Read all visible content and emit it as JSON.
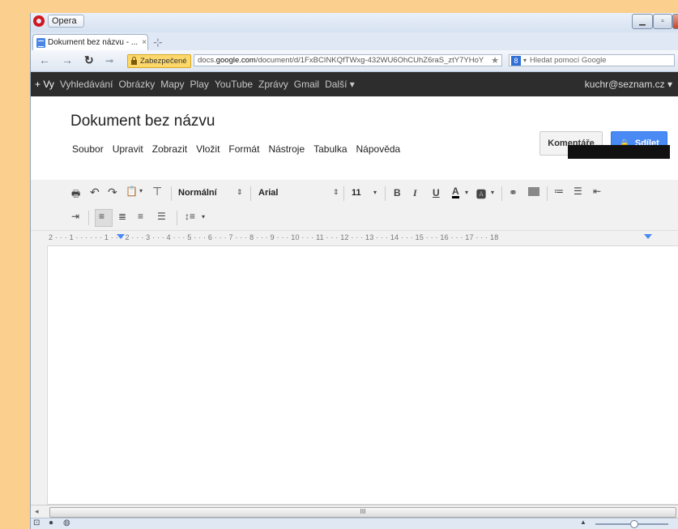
{
  "browser": {
    "app_label": "Opera",
    "tab_title": "Dokument bez názvu - ...",
    "secure_label": "Zabezpečené",
    "url_prefix": "docs.",
    "url_host": "google.com",
    "url_path": "/document/d/1FxBCINKQfTWxg-432WU6OhCUhZ6raS_ztY7YHoY",
    "search_placeholder": "Hledat pomocí Google"
  },
  "google_bar": {
    "items": [
      "+ Vy",
      "Vyhledávání",
      "Obrázky",
      "Mapy",
      "Play",
      "YouTube",
      "Zprávy",
      "Gmail",
      "Další ▾"
    ],
    "account": "kuchr@seznam.cz ▾"
  },
  "document": {
    "title": "Dokument bez názvu",
    "menu": [
      "Soubor",
      "Upravit",
      "Zobrazit",
      "Vložit",
      "Formát",
      "Nástroje",
      "Tabulka",
      "Nápověda"
    ],
    "comments_label": "Komentáře",
    "share_label": "Sdílet"
  },
  "toolbar": {
    "style_value": "Normální",
    "font_value": "Arial",
    "size_value": "11"
  },
  "ruler": {
    "labels": "2 · · · 1 · · · · · · 1 · · · 2 · · · 3 · · · 4 · · · 5 · · · 6 · · · 7 · · · 8 · · · 9 · · · 10 · · · 11 · · · 12 · · · 13 · · · 14 · · · 15 · · · 16 · · · 17 · · · 18"
  },
  "scrollbar": {
    "grip": "III"
  },
  "colors": {
    "google_bar": "#2d2d2d",
    "share_blue": "#4a8af4",
    "opera_red": "#d0171f",
    "desktop": "#fbcf8d"
  }
}
